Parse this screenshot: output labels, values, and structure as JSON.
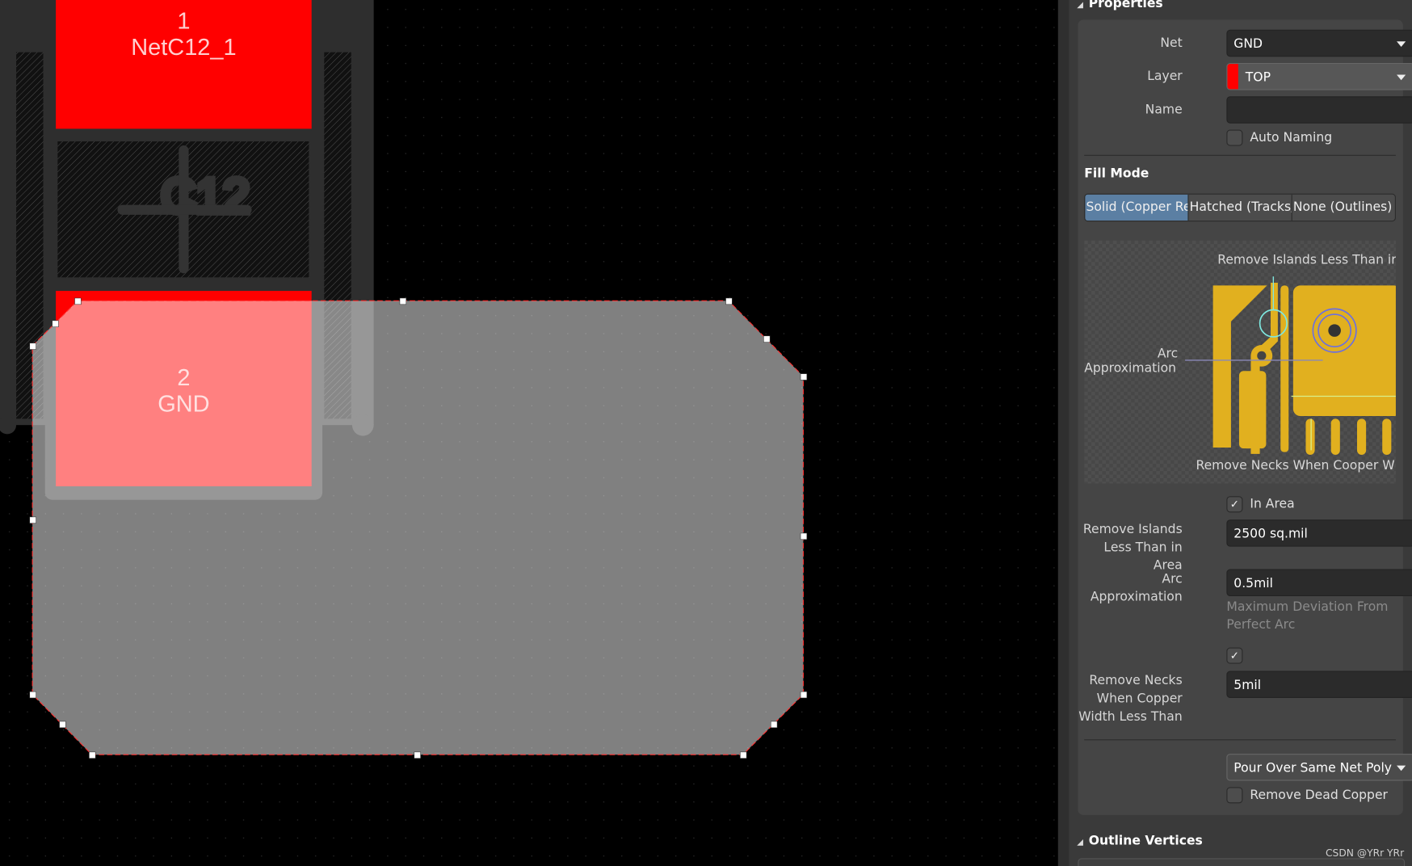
{
  "canvas": {
    "pad1": {
      "number": "1",
      "net": "NetC12_1"
    },
    "pad2": {
      "number": "2",
      "net": "GND"
    },
    "designator": "C12",
    "colors": {
      "pad": "#ff0000",
      "background": "#000000",
      "body": "#2e2e2e",
      "polygon_fill": "rgba(255,255,255,0.5)"
    }
  },
  "panel": {
    "properties_header": "Properties",
    "net": {
      "label": "Net",
      "value": "GND"
    },
    "layer": {
      "label": "Layer",
      "value": "TOP",
      "color": "#ff0000"
    },
    "name": {
      "label": "Name",
      "value": ""
    },
    "auto_naming": {
      "label": "Auto Naming",
      "checked": false
    },
    "fill_mode": {
      "title": "Fill Mode",
      "options": [
        "Solid (Copper Re",
        "Hatched (Tracks/",
        "None (Outlines)"
      ],
      "selected": 0
    },
    "illustration": {
      "label_islands": "Remove Islands Less Than ir",
      "label_arc_1": "Arc",
      "label_arc_2": "Approximation",
      "label_necks": "Remove Necks When Cooper W"
    },
    "in_area": {
      "label": "In Area",
      "checked": true
    },
    "remove_islands": {
      "label_1": "Remove Islands",
      "label_2": "Less Than in Area",
      "value": "2500 sq.mil"
    },
    "arc_approx": {
      "label_1": "Arc",
      "label_2": "Approximation",
      "value": "0.5mil",
      "hint_1": "Maximum Deviation From",
      "hint_2": "Perfect Arc"
    },
    "remove_necks": {
      "checked": true,
      "label_1": "Remove Necks",
      "label_2": "When Copper",
      "label_3": "Width Less Than",
      "value": "5mil"
    },
    "pour_over": {
      "value": "Pour Over Same Net Poly"
    },
    "remove_dead_copper": {
      "label": "Remove Dead Copper",
      "checked": false
    },
    "outline_header": "Outline Vertices",
    "watermark": "CSDN @YRr YRr"
  }
}
